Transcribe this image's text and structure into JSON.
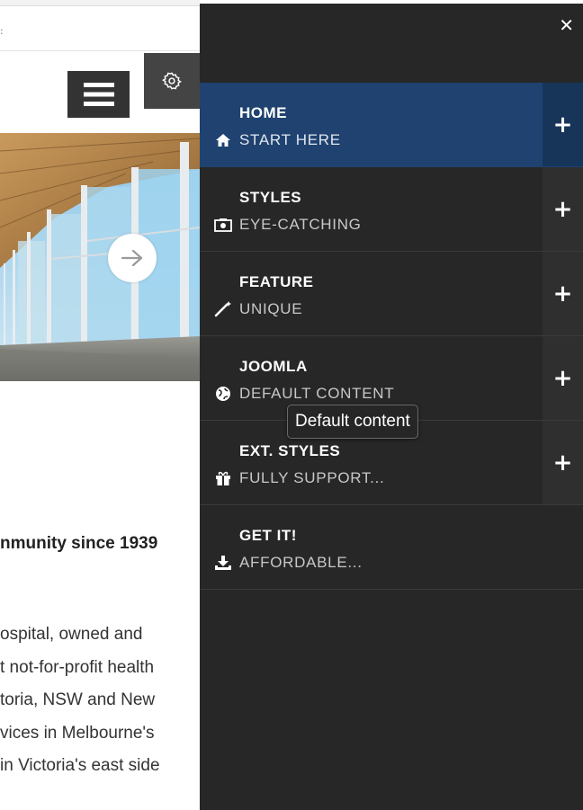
{
  "page": {
    "tagline": "nmunity since 1939",
    "paragraph_lines": [
      "ospital, owned and",
      "t not-for-profit health",
      "toria, NSW and New",
      "vices in Melbourne's",
      "in Victoria's east side"
    ],
    "hero_image": "building-glass-facade-photo"
  },
  "menu": {
    "close_icon": "close-icon",
    "items": [
      {
        "title": "HOME",
        "subtitle": "START HERE",
        "icon": "home-icon",
        "active": true,
        "expandable": true
      },
      {
        "title": "STYLES",
        "subtitle": "EYE-CATCHING",
        "icon": "camera-icon",
        "active": false,
        "expandable": true
      },
      {
        "title": "FEATURE",
        "subtitle": "UNIQUE",
        "icon": "magic-wand-icon",
        "active": false,
        "expandable": true
      },
      {
        "title": "JOOMLA",
        "subtitle": "DEFAULT CONTENT",
        "icon": "globe-icon",
        "active": false,
        "expandable": true
      },
      {
        "title": "EXT. STYLES",
        "subtitle": "FULLY SUPPORT...",
        "icon": "gift-icon",
        "active": false,
        "expandable": true
      },
      {
        "title": "GET IT!",
        "subtitle": "AFFORDABLE...",
        "icon": "download-icon",
        "active": false,
        "expandable": false
      }
    ],
    "expand_symbol": "+"
  },
  "tooltip": {
    "text": "Default content"
  },
  "colors": {
    "menu_bg": "#272727",
    "active_bg": "#1f4270",
    "active_plus_bg": "#173559",
    "plus_bg": "#2f2f2f"
  }
}
